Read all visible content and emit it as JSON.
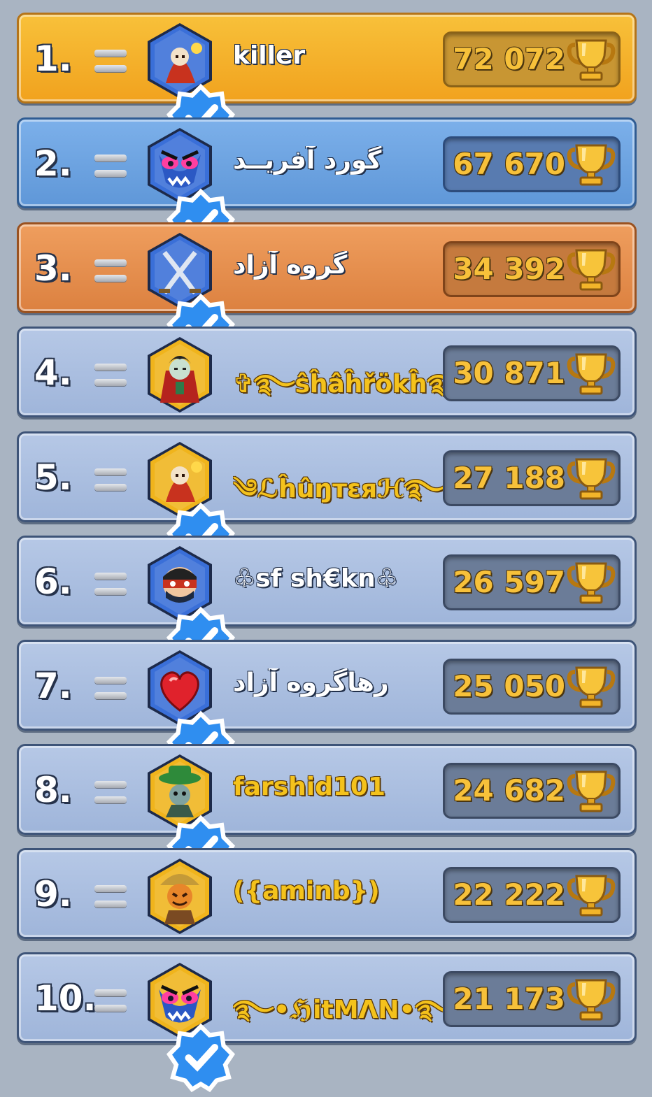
{
  "leaderboard": {
    "rows": [
      {
        "rank": "1.",
        "name": "killer",
        "score": "72 072",
        "theme": "gold",
        "avatar": "reaper-mage",
        "avatar_bg": "#3a6fd8",
        "verified": true,
        "name_style": "white"
      },
      {
        "rank": "2.",
        "name": "گورد آفریــد",
        "score": "67 670",
        "theme": "blue",
        "avatar": "angry-monster",
        "avatar_bg": "#3a6fd8",
        "verified": true,
        "name_style": "white"
      },
      {
        "rank": "3.",
        "name": "گروه آزاد",
        "score": "34 392",
        "theme": "bronze",
        "avatar": "crossed-swords",
        "avatar_bg": "#3a6fd8",
        "verified": true,
        "name_style": "white"
      },
      {
        "rank": "4.",
        "name": "✞࿐ŝĥâĥřökĥ࿐✞",
        "score": "30 871",
        "theme": "plain",
        "avatar": "vampire",
        "avatar_bg": "#f0b41c",
        "verified": false,
        "name_style": "gold"
      },
      {
        "rank": "5.",
        "name": "༄ℒĥûŋтεяℋ࿐",
        "score": "27 188",
        "theme": "plain",
        "avatar": "reaper-mage",
        "avatar_bg": "#f0b41c",
        "verified": true,
        "name_style": "gold"
      },
      {
        "rank": "6.",
        "name": "♧sf sh€kn♧",
        "score": "26 597",
        "theme": "plain",
        "avatar": "masked-ninja",
        "avatar_bg": "#3a6fd8",
        "verified": true,
        "name_style": "white"
      },
      {
        "rank": "7.",
        "name": "رهاگروه آزاد",
        "score": "25 050",
        "theme": "plain",
        "avatar": "red-heart",
        "avatar_bg": "#3a6fd8",
        "verified": true,
        "name_style": "white"
      },
      {
        "rank": "8.",
        "name": "farshid101",
        "score": "24 682",
        "theme": "plain",
        "avatar": "plague-hat",
        "avatar_bg": "#f0b41c",
        "verified": true,
        "name_style": "gold"
      },
      {
        "rank": "9.",
        "name": "({aminb})",
        "score": "22 222",
        "theme": "plain",
        "avatar": "scarecrow",
        "avatar_bg": "#f0b41c",
        "verified": false,
        "name_style": "gold"
      },
      {
        "rank": "10.",
        "name": "࿐•ℌitMΛN•࿐",
        "score": "21 173",
        "theme": "plain",
        "avatar": "angry-monster",
        "avatar_bg": "#f0b41c",
        "verified": true,
        "name_style": "gold"
      }
    ],
    "trophy_icon": "trophy-icon",
    "rank_change_icon": "no-change-icon",
    "verified_icon": "verified-check-icon"
  }
}
